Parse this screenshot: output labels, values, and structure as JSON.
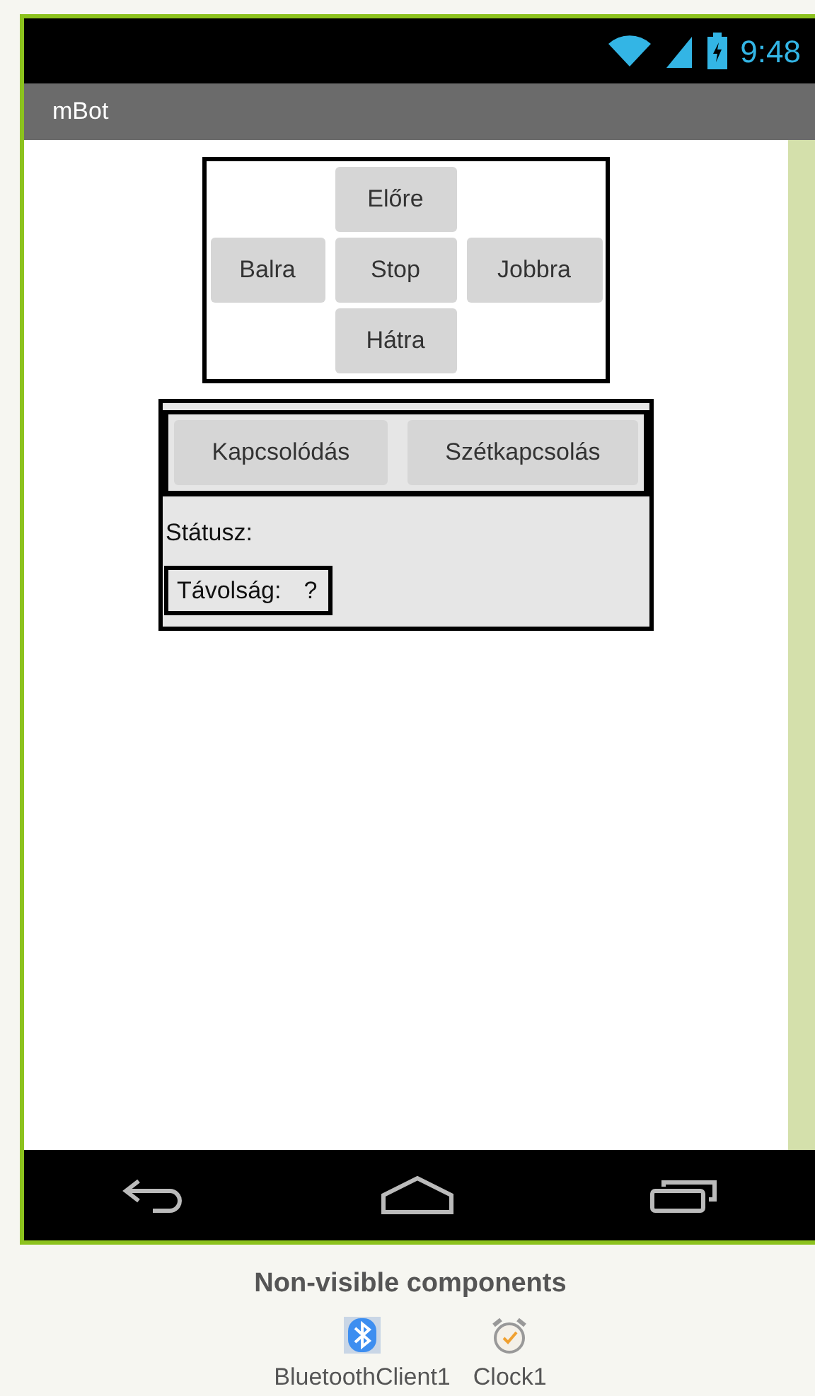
{
  "status_bar": {
    "time": "9:48"
  },
  "app_bar": {
    "title": "mBot"
  },
  "direction_pad": {
    "up": "Előre",
    "left": "Balra",
    "center": "Stop",
    "right": "Jobbra",
    "down": "Hátra"
  },
  "connection_panel": {
    "buttons": [
      "Kapcsolódás",
      "Szétkapcsolás"
    ],
    "status_label": "Státusz:",
    "distance_label": "Távolság:",
    "distance_value": "?"
  },
  "non_visible_components": {
    "title": "Non-visible components",
    "items": [
      {
        "kind": "bluetooth",
        "label": "BluetoothClient1"
      },
      {
        "kind": "clock",
        "label": "Clock1"
      }
    ]
  }
}
